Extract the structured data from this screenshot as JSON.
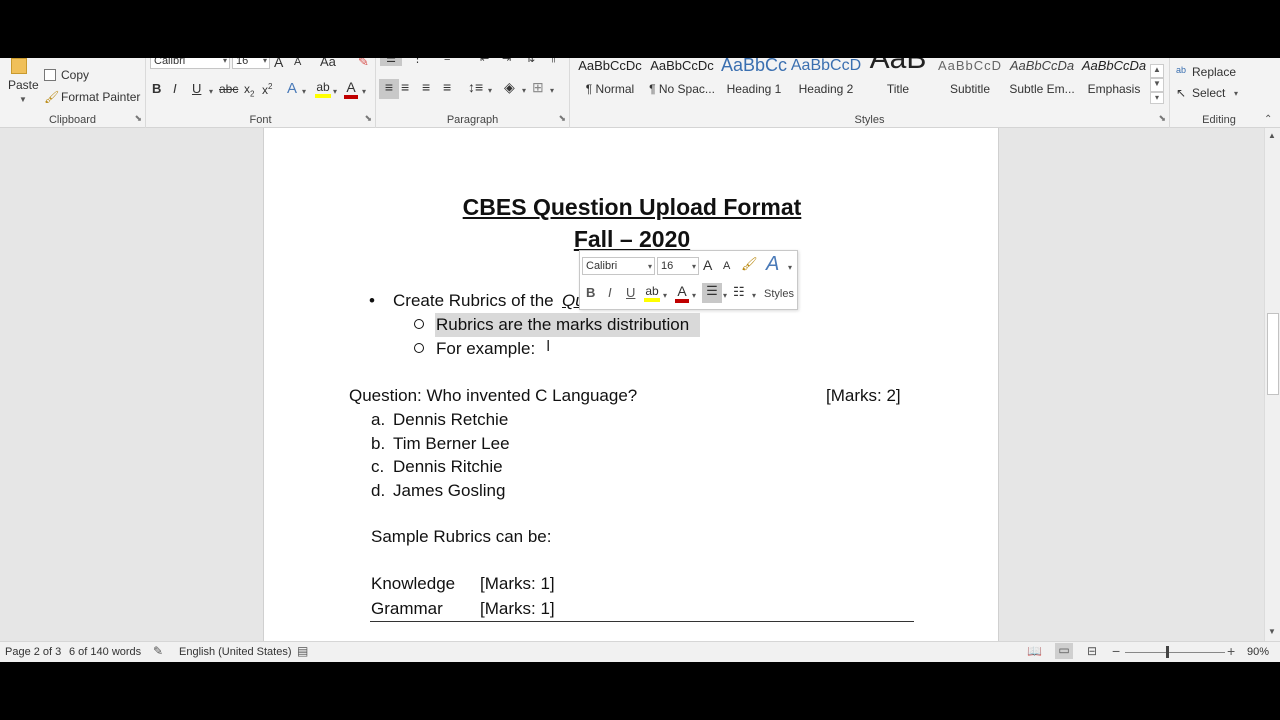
{
  "ribbon": {
    "clipboard": {
      "paste": "Paste",
      "copy": "Copy",
      "format_painter": "Format Painter",
      "label": "Clipboard"
    },
    "font": {
      "name": "Calibri",
      "size": "16",
      "label": "Font",
      "case": "Aa"
    },
    "paragraph": {
      "label": "Paragraph"
    },
    "styles": {
      "label": "Styles",
      "items": [
        {
          "preview": "AaBbCcDc",
          "name": "¶ Normal"
        },
        {
          "preview": "AaBbCcDc",
          "name": "¶ No Spac..."
        },
        {
          "preview": "AaBbCc",
          "name": "Heading 1"
        },
        {
          "preview": "AaBbCcD",
          "name": "Heading 2"
        },
        {
          "preview": "AaB",
          "name": "Title"
        },
        {
          "preview": "AaBbCcD",
          "name": "Subtitle"
        },
        {
          "preview": "AaBbCcDa",
          "name": "Subtle Em..."
        },
        {
          "preview": "AaBbCcDa",
          "name": "Emphasis"
        }
      ]
    },
    "editing": {
      "replace": "Replace",
      "select": "Select",
      "label": "Editing"
    }
  },
  "document": {
    "title": "CBES Question Upload Format",
    "subtitle": "Fall – 2020",
    "bullet1": "Create Rubrics of the",
    "bullet1_italic": "Question",
    "sub1": "Rubrics are the marks distribution",
    "sub2": "For example:",
    "question": "Question: Who invented C Language?",
    "question_marks": "[Marks: 2]",
    "options": [
      {
        "letter": "a.",
        "text": "Dennis Retchie"
      },
      {
        "letter": "b.",
        "text": "Tim Berner Lee"
      },
      {
        "letter": "c.",
        "text": "Dennis Ritchie"
      },
      {
        "letter": "d.",
        "text": "James Gosling"
      }
    ],
    "sample": "Sample Rubrics can be:",
    "rubrics": [
      {
        "name": "Knowledge",
        "marks": "[Marks: 1]"
      },
      {
        "name": "Grammar",
        "marks": "[Marks: 1]"
      }
    ]
  },
  "mini_toolbar": {
    "font": "Calibri",
    "size": "16",
    "styles": "Styles"
  },
  "status": {
    "page": "Page 2 of 3",
    "words": "6 of 140 words",
    "language": "English (United States)",
    "zoom": "90%"
  },
  "colors": {
    "highlight": "#ffff00",
    "font_color": "#c00000",
    "selection": "#d9d9d9"
  }
}
